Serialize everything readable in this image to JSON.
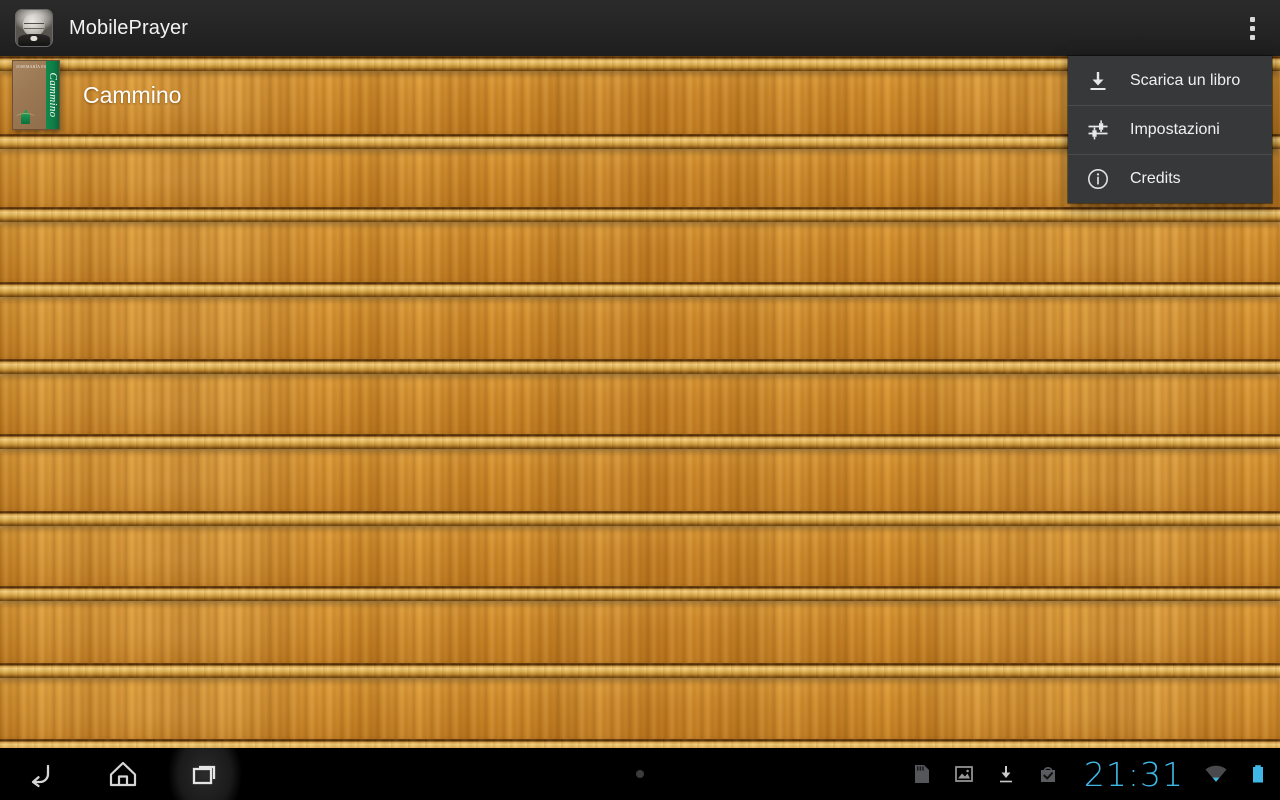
{
  "app": {
    "title": "MobilePrayer",
    "icon": "priest-portrait-icon",
    "overflow_icon": "overflow-menu-icon",
    "bar_color": "#242424"
  },
  "shelf": {
    "wood_color": "#c98424",
    "rail_color": "#e2b457",
    "rail_count": 9,
    "books": [
      {
        "title": "Cammino",
        "cover_author": "JOSEMARÍA ESCRIVÁ",
        "cover_band_title": "Cammino",
        "cover_band_color": "#0f7c46",
        "cover_background_color": "#9c7854"
      }
    ]
  },
  "overflow_menu": {
    "visible": true,
    "background_color": "#37383a",
    "items": [
      {
        "label": "Scarica un libro",
        "icon": "download-icon"
      },
      {
        "label": "Impostazioni",
        "icon": "settings-sliders-icon"
      },
      {
        "label": "Credits",
        "icon": "info-circle-icon"
      }
    ]
  },
  "nav_bar": {
    "background_color": "#000000",
    "buttons": [
      {
        "name": "back",
        "icon": "back-arrow-icon"
      },
      {
        "name": "home",
        "icon": "home-icon"
      },
      {
        "name": "recents",
        "icon": "recents-icon"
      }
    ],
    "menu_dot": "menu-dot-indicator",
    "status": {
      "clock": "21:31",
      "clock_color": "#3fb8e8",
      "icons": [
        {
          "name": "sd-card-icon"
        },
        {
          "name": "screenshot-image-icon"
        },
        {
          "name": "download-icon"
        },
        {
          "name": "play-store-bag-icon"
        },
        {
          "name": "wifi-icon"
        },
        {
          "name": "battery-icon"
        }
      ]
    }
  }
}
